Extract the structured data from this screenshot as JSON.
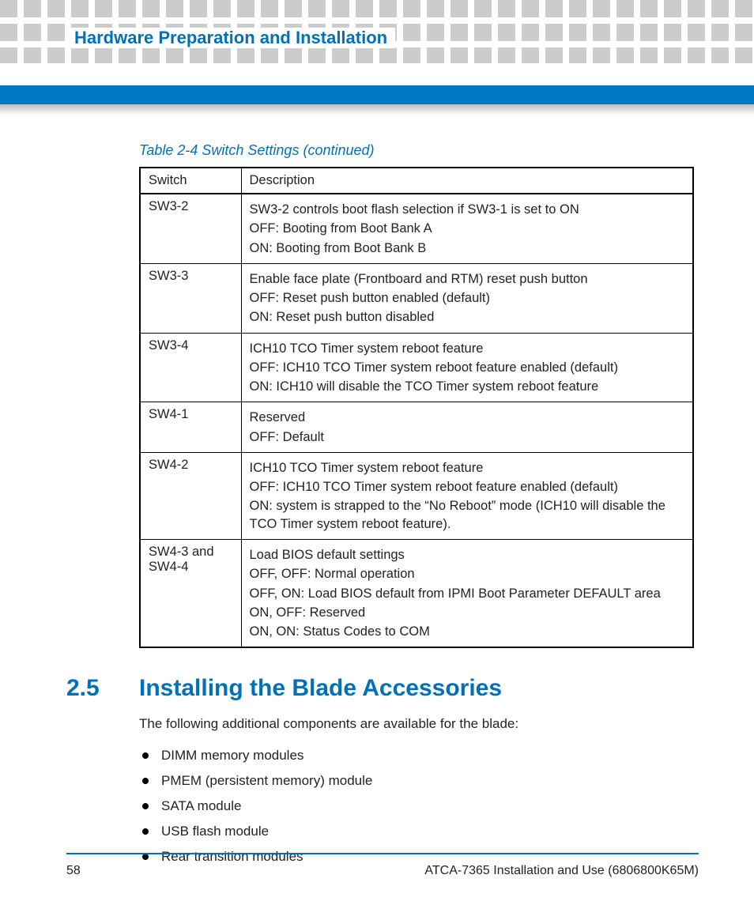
{
  "header": {
    "title": "Hardware Preparation and Installation"
  },
  "table": {
    "caption": "Table 2-4 Switch Settings  (continued)",
    "headers": {
      "switch": "Switch",
      "description": "Description"
    },
    "rows": [
      {
        "switch": "SW3-2",
        "lines": [
          "SW3-2 controls boot flash selection if SW3-1 is set to ON",
          "OFF: Booting from Boot Bank A",
          "ON: Booting from Boot Bank B"
        ]
      },
      {
        "switch": "SW3-3",
        "lines": [
          "Enable face plate (Frontboard and RTM) reset push button",
          "OFF: Reset push button enabled (default)",
          "ON: Reset push button disabled"
        ]
      },
      {
        "switch": "SW3-4",
        "lines": [
          "ICH10  TCO Timer system reboot feature",
          "OFF: ICH10 TCO Timer system reboot feature enabled (default)",
          "ON: ICH10 will disable the TCO Timer system reboot feature"
        ]
      },
      {
        "switch": "SW4-1",
        "lines": [
          "Reserved",
          "OFF: Default"
        ]
      },
      {
        "switch": "SW4-2",
        "lines": [
          "ICH10 TCO Timer system reboot feature",
          "OFF: ICH10 TCO Timer system reboot feature enabled (default)",
          "ON: system is strapped to the “No Reboot” mode (ICH10 will disable the TCO Timer system reboot feature)."
        ]
      },
      {
        "switch": "SW4-3 and SW4-4",
        "lines": [
          "Load BIOS default settings",
          "OFF, OFF: Normal operation",
          "OFF, ON: Load BIOS default from IPMI Boot Parameter DEFAULT area",
          "ON, OFF: Reserved",
          "ON, ON: Status Codes to COM"
        ]
      }
    ]
  },
  "section": {
    "number": "2.5",
    "title": "Installing the Blade Accessories",
    "intro": "The following additional components are available for the blade:",
    "bullets": [
      "DIMM memory modules",
      "PMEM (persistent memory) module",
      "SATA module",
      "USB flash module",
      "Rear transition modules"
    ]
  },
  "footer": {
    "page": "58",
    "doc": "ATCA-7365 Installation and Use (6806800K65M)"
  }
}
